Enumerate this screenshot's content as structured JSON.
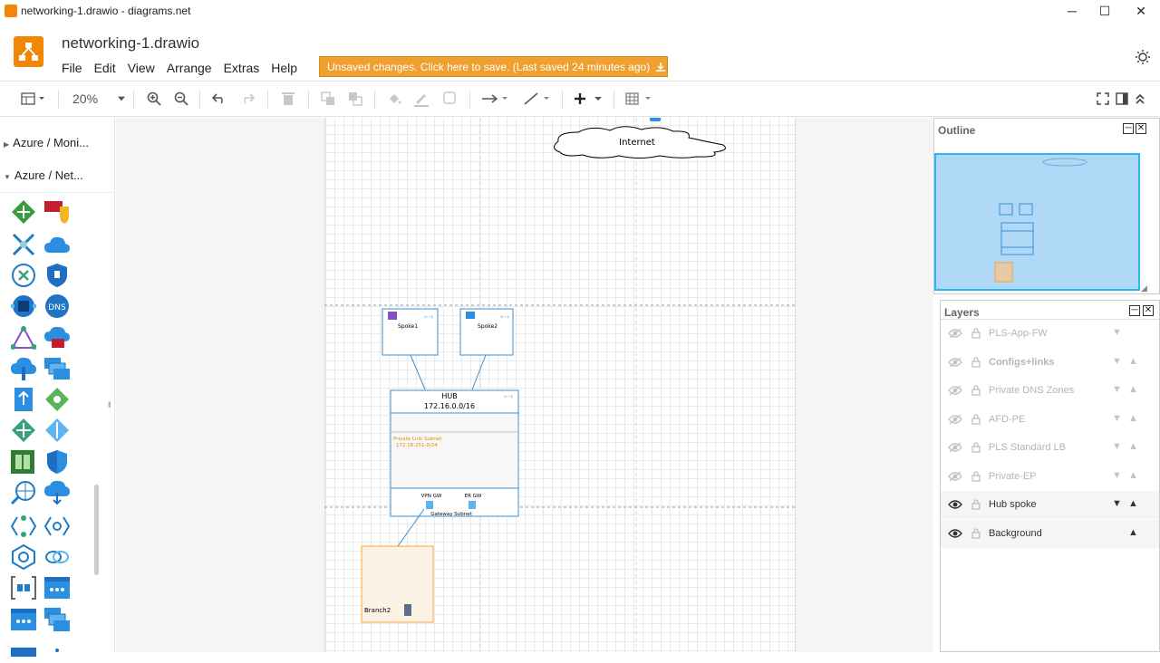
{
  "window": {
    "title": "networking-1.drawio - diagrams.net",
    "controls": [
      "minimize",
      "maximize",
      "close"
    ]
  },
  "header": {
    "doc_title": "networking-1.drawio",
    "menus": [
      "File",
      "Edit",
      "View",
      "Arrange",
      "Extras",
      "Help"
    ],
    "save_banner": "Unsaved changes. Click here to save. (Last saved 24 minutes ago)"
  },
  "toolbar": {
    "zoom": "20%"
  },
  "sidebar": {
    "categories": [
      "Azure / Moni...",
      "Azure / Net..."
    ]
  },
  "diagram": {
    "internet_label": "Internet",
    "spoke1": "Spoke1",
    "spoke2": "Spoke2",
    "hub_title": "HUB",
    "hub_cidr": "172.16.0.0/16",
    "private_link_subnet": "Private Link Subnet",
    "private_link_cidr": "172.16.251.0/24",
    "vpn_gw": "VPN GW",
    "er_gw": "ER GW",
    "gateway_subnet": "Gateway Subnet",
    "branch2": "Branch2"
  },
  "outline": {
    "title": "Outline"
  },
  "layers": {
    "title": "Layers",
    "items": [
      {
        "name": "PLS-App-FW",
        "visible": false,
        "down": true,
        "up": false
      },
      {
        "name": "Configs+links",
        "visible": false,
        "down": true,
        "up": true
      },
      {
        "name": "Private DNS Zones",
        "visible": false,
        "down": true,
        "up": true
      },
      {
        "name": "AFD-PE",
        "visible": false,
        "down": true,
        "up": true
      },
      {
        "name": "PLS Standard LB",
        "visible": false,
        "down": true,
        "up": true
      },
      {
        "name": "Private-EP",
        "visible": false,
        "down": true,
        "up": true
      },
      {
        "name": "Hub spoke",
        "visible": true,
        "down": true,
        "up": true
      },
      {
        "name": "Background",
        "visible": true,
        "down": false,
        "up": true
      }
    ]
  },
  "colors": {
    "brand_orange": "#f08705",
    "banner_orange": "#f0a030",
    "azure_blue": "#0078d4",
    "outline_blue": "#29b6f6"
  }
}
